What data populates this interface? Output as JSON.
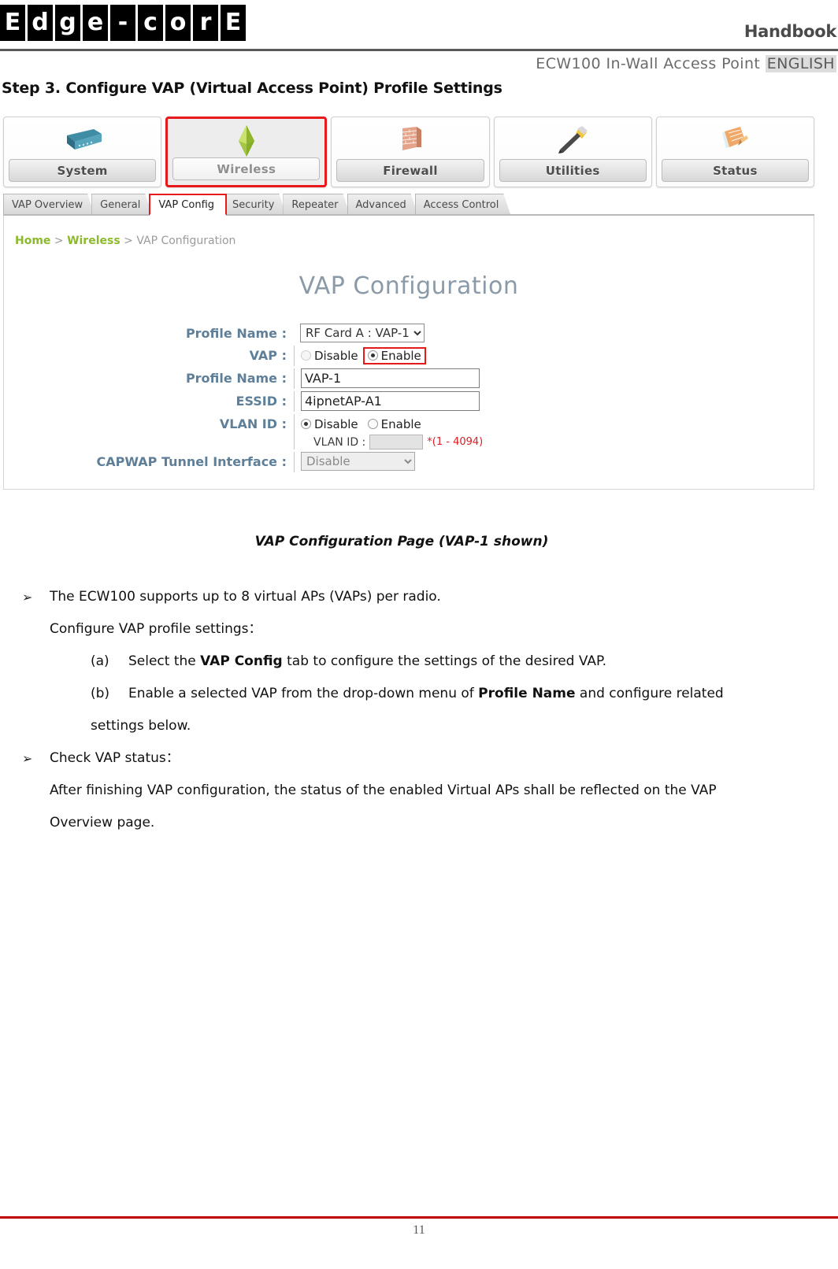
{
  "header": {
    "logo_letters": [
      "E",
      "d",
      "g",
      "e",
      "-",
      "c",
      "o",
      "r",
      "E"
    ],
    "handbook": "Handbook",
    "product_line": "ECW100 In-Wall Access Point",
    "language": "ENGLISH"
  },
  "step_title": "Step 3. Configure VAP (Virtual Access Point) Profile Settings",
  "ui": {
    "nav_buttons": [
      {
        "label": "System",
        "icon": "network-switch-icon",
        "selected": false
      },
      {
        "label": "Wireless",
        "icon": "wireless-antenna-icon",
        "selected": true
      },
      {
        "label": "Firewall",
        "icon": "brick-wall-icon",
        "selected": false
      },
      {
        "label": "Utilities",
        "icon": "hammer-icon",
        "selected": false
      },
      {
        "label": "Status",
        "icon": "document-pencil-icon",
        "selected": false
      }
    ],
    "tabs": [
      {
        "label": "VAP Overview",
        "active": false
      },
      {
        "label": "General",
        "active": false
      },
      {
        "label": "VAP Config",
        "active": true
      },
      {
        "label": "Security",
        "active": false
      },
      {
        "label": "Repeater",
        "active": false
      },
      {
        "label": "Advanced",
        "active": false
      },
      {
        "label": "Access Control",
        "active": false
      }
    ],
    "breadcrumb": {
      "home": "Home",
      "section": "Wireless",
      "page": "VAP Configuration",
      "separator": ">"
    },
    "panel_title": "VAP Configuration",
    "form": {
      "profile_select_label": "Profile Name :",
      "profile_select_value": "RF Card A : VAP-1",
      "vap_label": "VAP :",
      "vap_disable": "Disable",
      "vap_enable": "Enable",
      "vap_selected": "Enable",
      "profile_name_label": "Profile Name :",
      "profile_name_value": "VAP-1",
      "essid_label": "ESSID :",
      "essid_value": "4ipnetAP-A1",
      "vlan_label": "VLAN ID :",
      "vlan_disable": "Disable",
      "vlan_enable": "Enable",
      "vlan_selected": "Disable",
      "vlan_id_sub_label": "VLAN ID :",
      "vlan_id_value": "",
      "vlan_id_hint": "*(1 - 4094)",
      "capwap_label": "CAPWAP Tunnel Interface :",
      "capwap_value": "Disable"
    },
    "highlight_color": "#e8191b"
  },
  "figure_caption": "VAP Configuration Page (VAP-1 shown)",
  "body": {
    "bullet_mark": "➢",
    "b1_text": "The ECW100 supports up to 8 virtual APs (VAPs) per radio.",
    "b1_cont": "Configure VAP profile settings：",
    "a_mark": "(a)",
    "a_pre": "Select the ",
    "a_bold": "VAP Config",
    "a_post": " tab to configure the settings of the desired VAP.",
    "b_mark": "(b)",
    "b_pre": "Enable a selected VAP from the drop-down menu of ",
    "b_bold": "Profile Name",
    "b_post": " and configure related",
    "b_cont": "settings below.",
    "b2_text": "Check VAP status：",
    "b2_cont1": "After finishing VAP configuration, the status of the enabled Virtual APs shall be reflected on the VAP",
    "b2_cont2": "Overview page."
  },
  "footer": {
    "page_number": "11",
    "rule_color": "#c00000"
  }
}
